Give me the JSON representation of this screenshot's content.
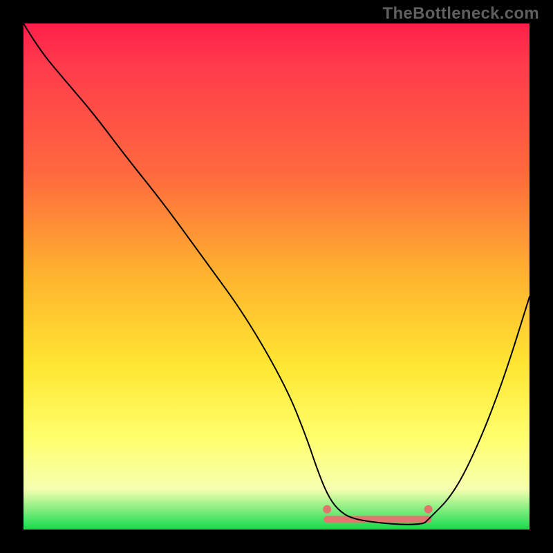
{
  "watermark": {
    "text": "TheBottleneck.com"
  },
  "plot": {
    "gradient_colors": [
      "#ff1f4a",
      "#ff6a3e",
      "#ffb42e",
      "#ffe733",
      "#ffff6d",
      "#2fe05a"
    ]
  },
  "chart_data": {
    "type": "line",
    "title": "",
    "xlabel": "",
    "ylabel": "",
    "xlim": [
      0,
      100
    ],
    "ylim": [
      0,
      100
    ],
    "series": [
      {
        "name": "curve",
        "x": [
          0,
          3,
          8,
          14,
          20,
          28,
          36,
          44,
          52,
          56,
          58,
          60,
          62,
          65,
          73,
          79,
          80,
          85,
          90,
          95,
          100
        ],
        "values": [
          100,
          95,
          89,
          82,
          74,
          64,
          53,
          42,
          28,
          18,
          12,
          7,
          4,
          2,
          1,
          1,
          2,
          7,
          17,
          30,
          46
        ]
      }
    ],
    "highlight_range": {
      "x_start": 60,
      "x_end": 80,
      "y": 2
    },
    "highlight_dots": [
      {
        "x": 60,
        "y": 4
      },
      {
        "x": 80,
        "y": 4
      }
    ]
  }
}
